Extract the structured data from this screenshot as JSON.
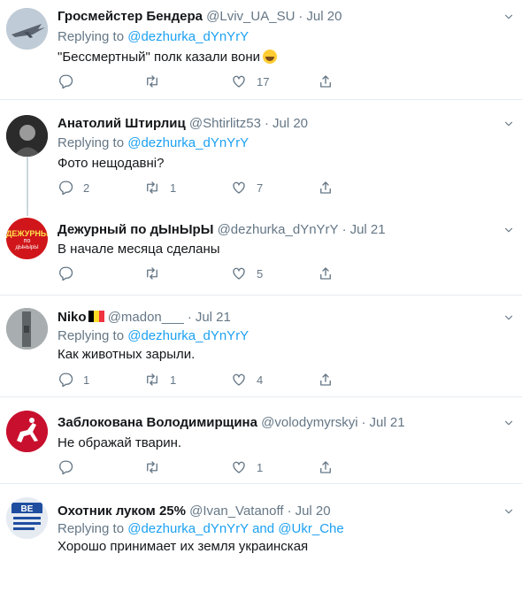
{
  "tweets": [
    {
      "name": "Гросмейстер Бендера",
      "handle": "@Lviv_UA_SU",
      "time": "Jul 20",
      "replying_prefix": "Replying to",
      "replying_to": "@dezhurka_dYnYrY",
      "replying_and": "",
      "replying_to2": "",
      "text": "\"Бессмертный\" полк казали вони",
      "replies": "",
      "retweets": "",
      "likes": "17"
    },
    {
      "name": "Анатолий Штирлиц",
      "handle": "@Shtirlitz53",
      "time": "Jul 20",
      "replying_prefix": "Replying to",
      "replying_to": "@dezhurka_dYnYrY",
      "replying_and": "",
      "replying_to2": "",
      "text": "Фото нещодавні?",
      "replies": "2",
      "retweets": "1",
      "likes": "7"
    },
    {
      "name": "Дежурный по дЫнЫрЫ",
      "handle": "@dezhurka_dYnYrY",
      "time": "Jul 21",
      "avatar_label": "ДЕЖУРНЫЙ",
      "avatar_sub": "по",
      "avatar_sub2": "дЫнЫрЫ",
      "text": "В начале месяца сделаны",
      "replies": "",
      "retweets": "",
      "likes": "5"
    },
    {
      "name": "Niko",
      "handle": "@madon___",
      "time": "Jul 21",
      "replying_prefix": "Replying to",
      "replying_to": "@dezhurka_dYnYrY",
      "text": "Как животных зарыли.",
      "replies": "1",
      "retweets": "1",
      "likes": "4"
    },
    {
      "name": "Заблокована Володимирщина",
      "handle": "@volodymyrskyi",
      "time": "Jul 21",
      "text": "Не ображай тварин.",
      "replies": "",
      "retweets": "",
      "likes": "1"
    },
    {
      "name": "Охотник луком 25%",
      "handle": "@Ivan_Vatanoff",
      "time": "Jul 20",
      "replying_prefix": "Replying to",
      "replying_to": "@dezhurka_dYnYrY",
      "replying_and": "and",
      "replying_to2": "@Ukr_Che",
      "text": "Хорошо принимает их земля украинская",
      "avatar_label": "ВЕ"
    }
  ],
  "colors": {
    "accent": "#1da1f2",
    "muted": "#657786",
    "border": "#e6ecf0",
    "thread": "#ccd6dd"
  },
  "icons": [
    "reply-icon",
    "retweet-icon",
    "like-icon",
    "share-icon",
    "caret-down-icon"
  ]
}
